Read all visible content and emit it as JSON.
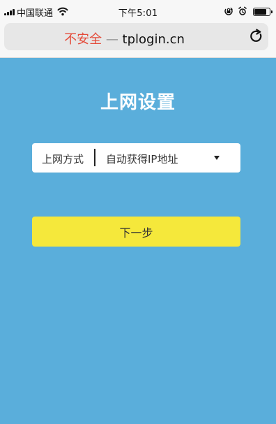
{
  "status_bar": {
    "carrier": "中国联通",
    "time": "下午5:01",
    "signal_bars": 4,
    "battery_level": 0.85,
    "icons": [
      "signal-icon",
      "wifi-icon",
      "orientation-lock-icon",
      "alarm-icon",
      "battery-icon"
    ]
  },
  "browser": {
    "security_text": "不安全",
    "separator": "—",
    "domain": "tplogin.cn",
    "reload_icon": "reload-icon"
  },
  "page": {
    "title": "上网设置",
    "field": {
      "label": "上网方式",
      "selected": "自动获得IP地址",
      "dropdown_icon": "caret-down-icon"
    },
    "next_button": "下一步"
  },
  "colors": {
    "background": "#5aaedb",
    "button": "#f5e83b",
    "insecure": "#e44b3a",
    "title": "#ffffff"
  }
}
